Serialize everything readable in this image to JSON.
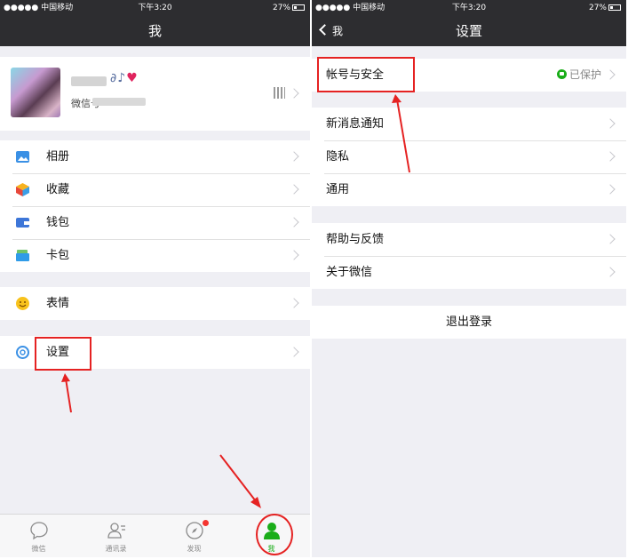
{
  "status_bar": {
    "carrier": "●●●●● 中国移动",
    "time": "下午3:20",
    "battery": "27%"
  },
  "left": {
    "nav_title": "我",
    "profile": {
      "wechat_id_prefix": "微信号"
    },
    "menu_items": [
      {
        "label": "相册",
        "icon": "photo-album-icon"
      },
      {
        "label": "收藏",
        "icon": "favorites-cube-icon"
      },
      {
        "label": "钱包",
        "icon": "wallet-icon"
      },
      {
        "label": "卡包",
        "icon": "card-holder-icon"
      },
      {
        "label": "表情",
        "icon": "smiley-icon"
      },
      {
        "label": "设置",
        "icon": "gear-icon"
      }
    ],
    "tabs": [
      {
        "label": "微信",
        "icon": "chat-bubble-icon"
      },
      {
        "label": "通讯录",
        "icon": "contacts-icon"
      },
      {
        "label": "发现",
        "icon": "compass-icon"
      },
      {
        "label": "我",
        "icon": "person-icon"
      }
    ]
  },
  "right": {
    "nav_title": "设置",
    "back_label": "我",
    "account_row": {
      "label": "帐号与安全",
      "status": "已保护"
    },
    "items": [
      "新消息通知",
      "隐私",
      "通用",
      "帮助与反馈",
      "关于微信"
    ],
    "logout_label": "退出登录"
  },
  "colors": {
    "nav_bg": "#2d2d30",
    "accent_green": "#1aad19",
    "highlight_red": "#e52222",
    "page_bg": "#efeff4"
  }
}
